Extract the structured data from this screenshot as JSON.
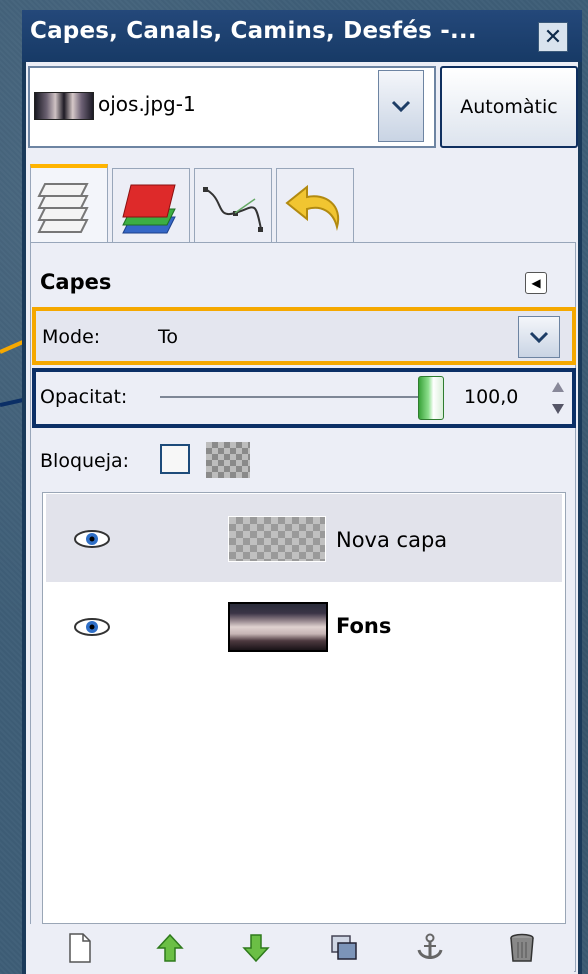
{
  "window": {
    "title": "Capes, Canals, Camins, Desfés -..."
  },
  "image_selector": {
    "value": "ojos.jpg-1",
    "auto_button": "Automàtic"
  },
  "tabs": [
    {
      "icon": "layers-icon",
      "active": true
    },
    {
      "icon": "channels-icon",
      "active": false
    },
    {
      "icon": "paths-icon",
      "active": false
    },
    {
      "icon": "undo-history-icon",
      "active": false
    }
  ],
  "layers_panel": {
    "title": "Capes",
    "mode_label": "Mode:",
    "mode_value": "To",
    "opacity_label": "Opacitat:",
    "opacity_value": "100,0",
    "lock_label": "Bloqueja:"
  },
  "layers": [
    {
      "name": "Nova capa",
      "visible": true,
      "selected": true,
      "bold": false
    },
    {
      "name": "Fons",
      "visible": true,
      "selected": false,
      "bold": true
    }
  ],
  "bottom_toolbar": [
    "new-layer-icon",
    "raise-layer-icon",
    "lower-layer-icon",
    "duplicate-layer-icon",
    "anchor-layer-icon",
    "delete-layer-icon"
  ],
  "colors": {
    "highlight_mode": "#f5a800",
    "highlight_opacity": "#0b2f66",
    "titlebar": "#1c3f6e"
  }
}
